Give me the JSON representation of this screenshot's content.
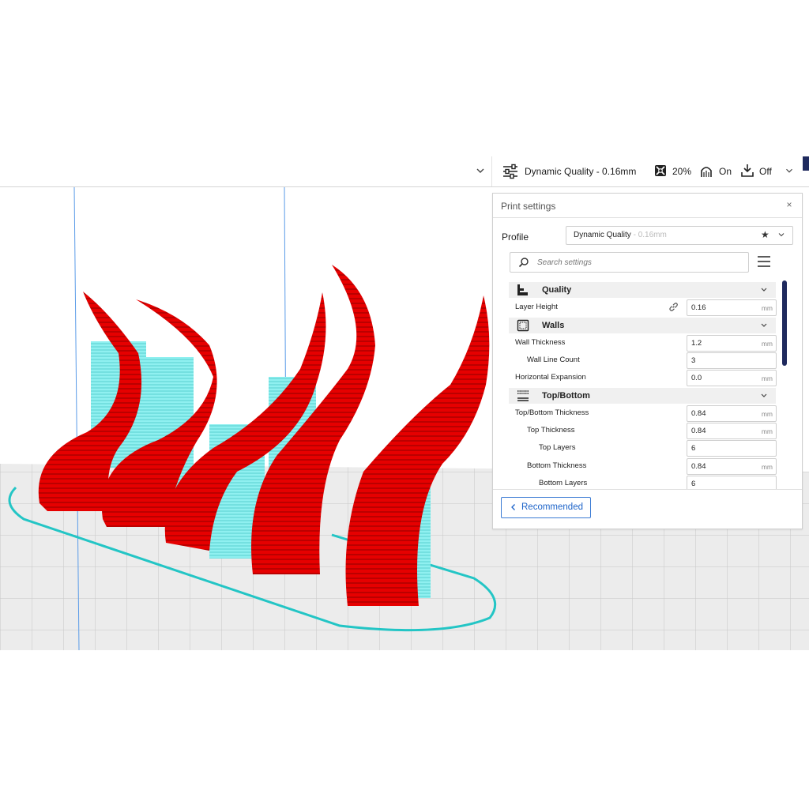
{
  "header": {
    "profile_summary": "Dynamic Quality - 0.16mm",
    "infill": "20%",
    "support": "On",
    "adhesion": "Off"
  },
  "panel": {
    "title": "Print settings",
    "close_glyph": "×",
    "profile_label": "Profile",
    "profile_value": "Dynamic Quality",
    "profile_value_sub": " - 0.16mm",
    "search_placeholder": "Search settings",
    "categories": {
      "quality": "Quality",
      "walls": "Walls",
      "topbottom": "Top/Bottom"
    },
    "settings": {
      "layer_height": {
        "label": "Layer Height",
        "value": "0.16",
        "unit": "mm"
      },
      "wall_thickness": {
        "label": "Wall Thickness",
        "value": "1.2",
        "unit": "mm"
      },
      "wall_line_count": {
        "label": "Wall Line Count",
        "value": "3"
      },
      "horizontal_expansion": {
        "label": "Horizontal Expansion",
        "value": "0.0",
        "unit": "mm"
      },
      "topbottom_thickness": {
        "label": "Top/Bottom Thickness",
        "value": "0.84",
        "unit": "mm"
      },
      "top_thickness": {
        "label": "Top Thickness",
        "value": "0.84",
        "unit": "mm"
      },
      "top_layers": {
        "label": "Top Layers",
        "value": "6"
      },
      "bottom_thickness": {
        "label": "Bottom Thickness",
        "value": "0.84",
        "unit": "mm"
      },
      "bottom_layers": {
        "label": "Bottom Layers",
        "value": "6"
      }
    },
    "recommended_label": "Recommended"
  },
  "colors": {
    "model_red": "#e60000",
    "support_cyan": "#7fe6e6",
    "accent_blue": "#1c63c9",
    "scrollbar_navy": "#1f2a5e"
  },
  "icons": {
    "settings": "sliders-icon",
    "infill": "infill-icon",
    "support": "support-icon",
    "adhesion": "adhesion-icon",
    "search": "search-icon",
    "menu": "hamburger-icon"
  }
}
